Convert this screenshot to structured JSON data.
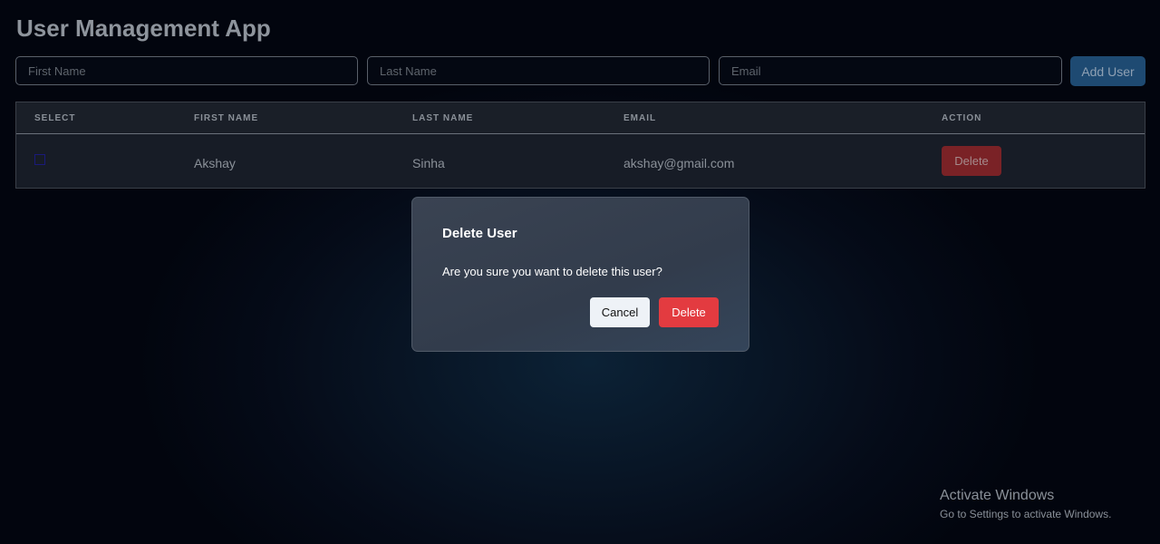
{
  "app": {
    "title": "User Management App"
  },
  "form": {
    "first_name_placeholder": "First Name",
    "last_name_placeholder": "Last Name",
    "email_placeholder": "Email",
    "add_label": "Add User"
  },
  "table": {
    "headers": [
      "SELECT",
      "FIRST NAME",
      "LAST NAME",
      "EMAIL",
      "ACTION"
    ],
    "rows": [
      {
        "selected": false,
        "first_name": "Akshay",
        "last_name": "Sinha",
        "email": "akshay@gmail.com",
        "action": "Delete"
      }
    ]
  },
  "modal": {
    "title": "Delete User",
    "message": "Are you sure you want to delete this user?",
    "cancel_label": "Cancel",
    "confirm_label": "Delete"
  },
  "watermark": {
    "title": "Activate Windows",
    "subtitle": "Go to Settings to activate Windows."
  },
  "colors": {
    "accent": "#1e4a72",
    "danger": "#e33b40"
  }
}
